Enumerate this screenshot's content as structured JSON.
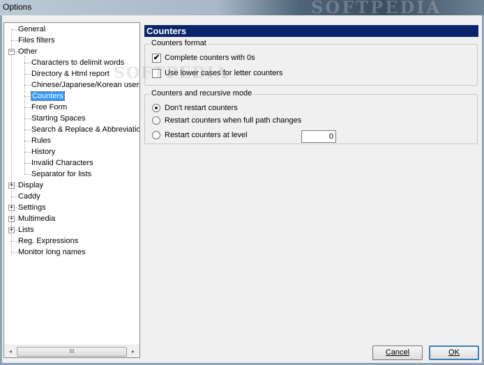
{
  "window": {
    "title": "Options",
    "watermark": "SOFTPEDIA"
  },
  "tree": {
    "items": [
      {
        "label": "General",
        "level": 0,
        "expander": ""
      },
      {
        "label": "Files filters",
        "level": 0,
        "expander": ""
      },
      {
        "label": "Other",
        "level": 0,
        "expander": "−"
      },
      {
        "label": "Characters to delimit words",
        "level": 1,
        "expander": ""
      },
      {
        "label": "Directory & Html report",
        "level": 1,
        "expander": ""
      },
      {
        "label": "Chinese/Japanese/Korean users",
        "level": 1,
        "expander": ""
      },
      {
        "label": "Counters",
        "level": 1,
        "expander": "",
        "selected": true
      },
      {
        "label": "Free Form",
        "level": 1,
        "expander": ""
      },
      {
        "label": "Starting Spaces",
        "level": 1,
        "expander": ""
      },
      {
        "label": "Search & Replace & Abbreviations",
        "level": 1,
        "expander": ""
      },
      {
        "label": "Rules",
        "level": 1,
        "expander": ""
      },
      {
        "label": "History",
        "level": 1,
        "expander": ""
      },
      {
        "label": "Invalid Characters",
        "level": 1,
        "expander": ""
      },
      {
        "label": "Separator for lists",
        "level": 1,
        "expander": ""
      },
      {
        "label": "Display",
        "level": 0,
        "expander": "+"
      },
      {
        "label": "Caddy",
        "level": 0,
        "expander": ""
      },
      {
        "label": "Settings",
        "level": 0,
        "expander": "+"
      },
      {
        "label": "Multimedia",
        "level": 0,
        "expander": "+"
      },
      {
        "label": "Lists",
        "level": 0,
        "expander": "+"
      },
      {
        "label": "Reg. Expressions",
        "level": 0,
        "expander": ""
      },
      {
        "label": "Monitor long names",
        "level": 0,
        "expander": ""
      }
    ],
    "scroll_left": "◂",
    "scroll_right": "▸",
    "scroll_grip": "III"
  },
  "panel": {
    "header": "Counters",
    "counters_format": {
      "legend": "Counters format",
      "complete_zeros": {
        "label": "Complete counters with 0s",
        "checked": true
      },
      "lower_cases": {
        "label": "Use lower cases for letter counters",
        "checked": false
      }
    },
    "recursive_mode": {
      "legend": "Counters and recursive mode",
      "dont_restart": {
        "label": "Don't restart counters",
        "selected": true
      },
      "restart_path": {
        "label": "Restart counters when full path changes",
        "selected": false
      },
      "restart_level": {
        "label": "Restart counters at level",
        "selected": false
      },
      "level_value": "0"
    },
    "overlay_watermark": "SOFTPEDIA"
  },
  "buttons": {
    "cancel": "Cancel",
    "ok": "OK"
  },
  "colors": {
    "header_bg": "#0a246a",
    "selection": "#3399ff"
  }
}
